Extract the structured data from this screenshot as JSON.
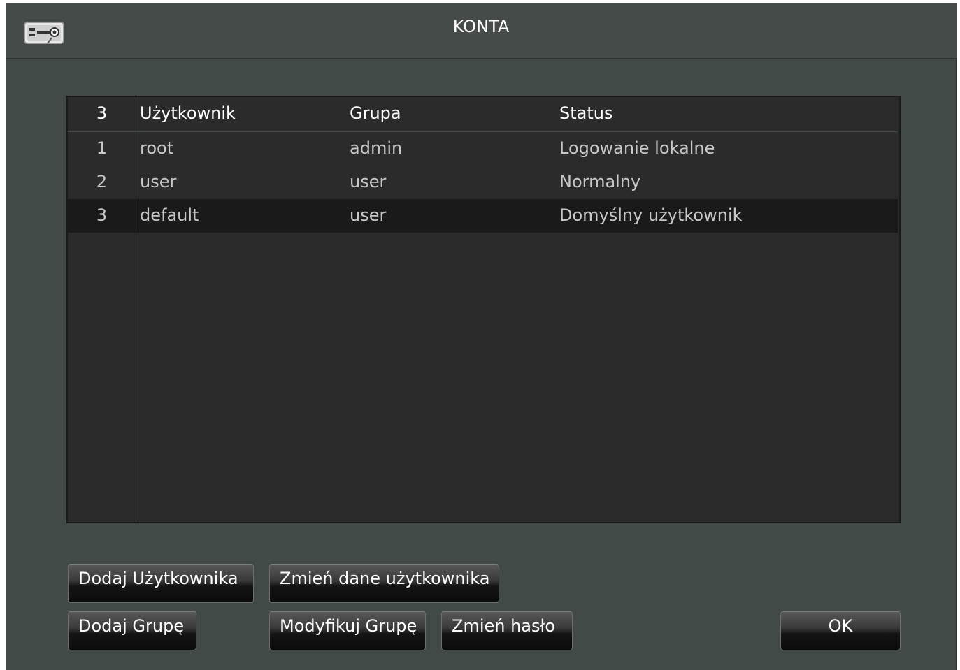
{
  "window": {
    "title": "KONTA",
    "icon": "dvr-account-icon"
  },
  "table": {
    "headers": {
      "count": "3",
      "user": "Użytkownik",
      "group": "Grupa",
      "status": "Status"
    },
    "rows": [
      {
        "num": "1",
        "user": "root",
        "group": "admin",
        "status": "Logowanie lokalne"
      },
      {
        "num": "2",
        "user": "user",
        "group": "user",
        "status": "Normalny"
      },
      {
        "num": "3",
        "user": "default",
        "group": "user",
        "status": "Domyślny użytkownik",
        "selected": true
      }
    ]
  },
  "buttons": {
    "add_user": "Dodaj Użytkownika",
    "modify_user": "Zmień dane użytkownika",
    "add_group": "Dodaj Grupę",
    "modify_group": "Modyfikuj Grupę",
    "change_password": "Zmień hasło",
    "ok": "OK"
  },
  "colors": {
    "window_bg": "#424a48",
    "table_bg": "#2b2b2b",
    "selected_row_bg": "#1a1a1a"
  }
}
